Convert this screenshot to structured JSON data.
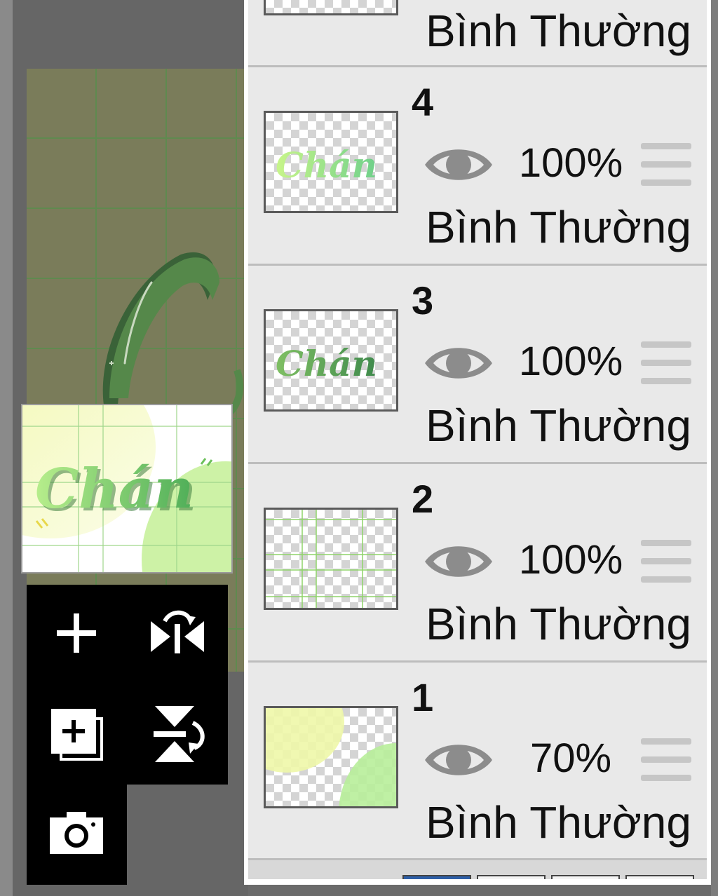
{
  "canvas": {
    "preview_text": "Chán"
  },
  "toolbox": {
    "add_icon": "plus-icon",
    "flip_h_icon": "flip-horizontal-icon",
    "add_layer_icon": "add-layer-icon",
    "flip_v_icon": "flip-vertical-icon",
    "camera_icon": "camera-icon"
  },
  "layers": {
    "top_partial": {
      "blend_mode": "Bình Thường"
    },
    "items": [
      {
        "number": "4",
        "opacity": "100%",
        "blend_mode": "Bình Thường",
        "thumb_text": "Chán"
      },
      {
        "number": "3",
        "opacity": "100%",
        "blend_mode": "Bình Thường",
        "thumb_text": "Chán"
      },
      {
        "number": "2",
        "opacity": "100%",
        "blend_mode": "Bình Thường"
      },
      {
        "number": "1",
        "opacity": "70%",
        "blend_mode": "Bình Thường"
      }
    ]
  },
  "colors": {
    "accent_green": "#8fd46a",
    "light_yellow": "#eef7a8",
    "panel_bg": "#e9e9e9"
  }
}
